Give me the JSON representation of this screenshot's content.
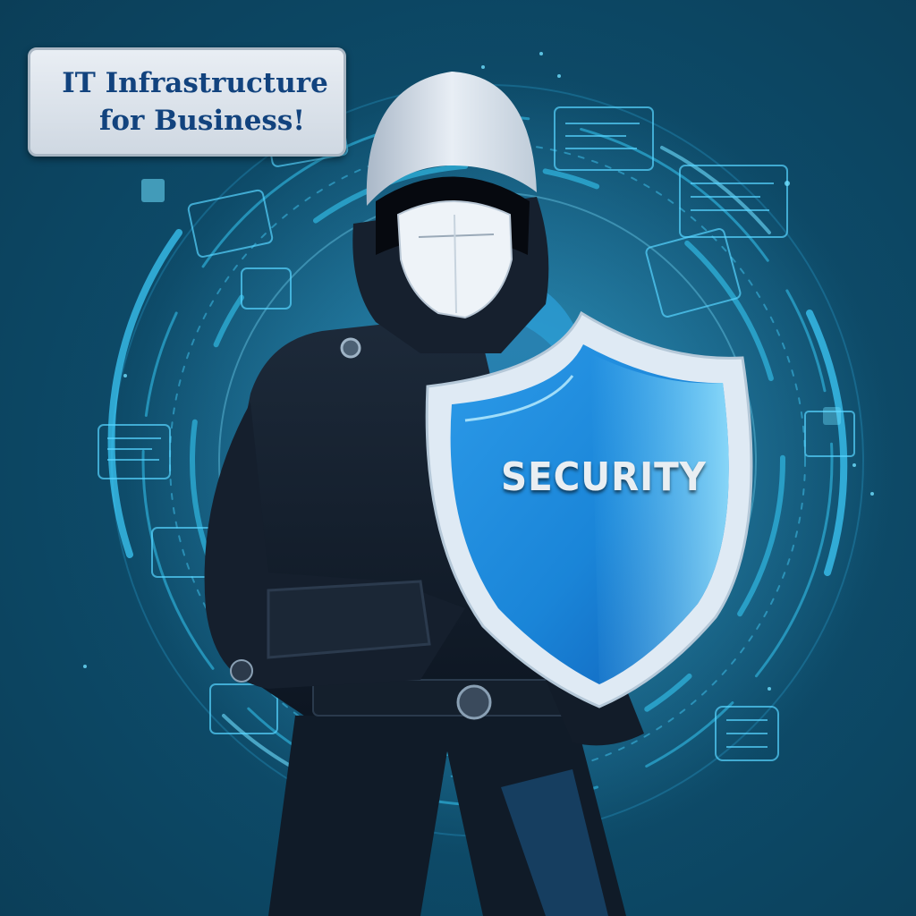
{
  "banner": {
    "line1": "IT Infrastructure",
    "line2": "for Business!"
  },
  "shield": {
    "label": "SECURITY"
  },
  "colors": {
    "background": "#0d4660",
    "accent_cyan": "#35c6f2",
    "shield_blue": "#1d8fe0",
    "banner_text": "#12437e"
  }
}
